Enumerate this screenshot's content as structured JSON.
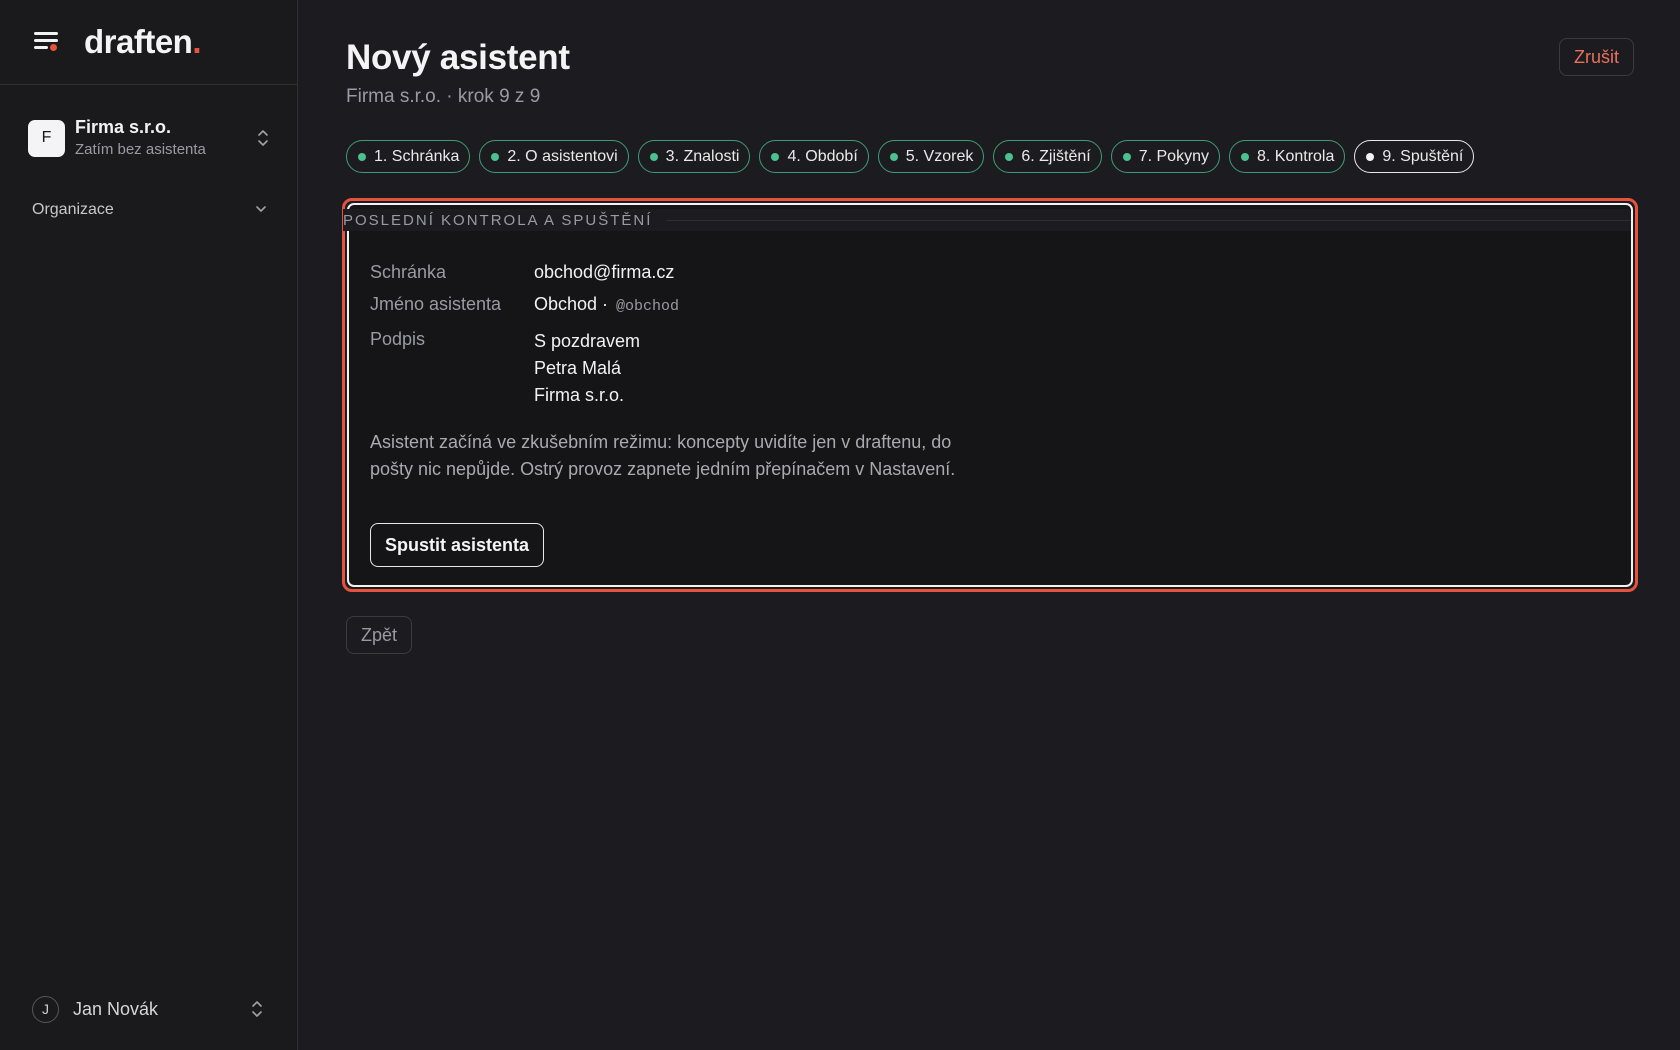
{
  "app": {
    "logo_text": "draften",
    "logo_accent": "#e5533d"
  },
  "sidebar": {
    "org": {
      "avatar_letter": "F",
      "name": "Firma s.r.o.",
      "subtitle": "Zatím bez asistenta"
    },
    "section": {
      "label": "Organizace"
    },
    "user": {
      "avatar_letter": "J",
      "name": "Jan Novák"
    }
  },
  "header": {
    "title": "Nový asistent",
    "subtitle": "Firma s.r.o. · krok 9 z 9",
    "cancel_label": "Zrušit"
  },
  "steps": [
    {
      "label": "1. Schránka",
      "done": true
    },
    {
      "label": "2. O asistentovi",
      "done": true
    },
    {
      "label": "3. Znalosti",
      "done": true
    },
    {
      "label": "4. Období",
      "done": true
    },
    {
      "label": "5. Vzorek",
      "done": true
    },
    {
      "label": "6. Zjištění",
      "done": true
    },
    {
      "label": "7. Pokyny",
      "done": true
    },
    {
      "label": "8. Kontrola",
      "done": true
    },
    {
      "label": "9. Spuštění",
      "active": true
    }
  ],
  "review": {
    "section_title": "POSLEDNÍ KONTROLA A SPUŠTĚNÍ",
    "mailbox_label": "Schránka",
    "mailbox_value": "obchod@firma.cz",
    "name_label": "Jméno asistenta",
    "name_value": "Obchod ·",
    "name_handle": "@obchod",
    "signature_label": "Podpis",
    "signature_lines": [
      "S pozdravem",
      "Petra Malá",
      "Firma s.r.o."
    ],
    "note": "Asistent začíná ve zkušebním režimu: koncepty uvidíte jen v draftenu, do pošty nic nepůjde. Ostrý provoz zapnete jedním přepínačem v Nastavení.",
    "launch_label": "Spustit asistenta"
  },
  "footer": {
    "back_label": "Zpět"
  },
  "colors": {
    "done": "#4cc08e",
    "danger": "#e5533d",
    "background": "#1c1c20"
  }
}
